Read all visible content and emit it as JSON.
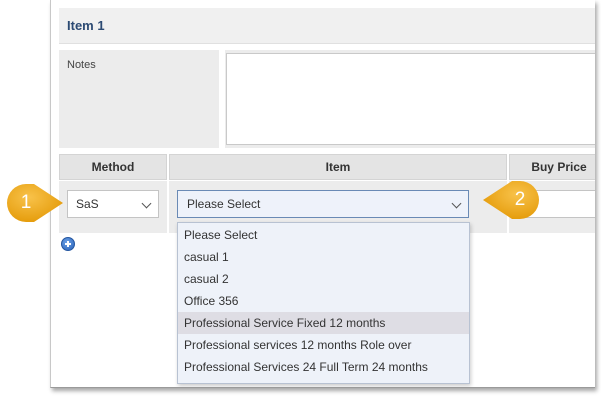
{
  "item": {
    "title": "Item 1",
    "notes_label": "Notes",
    "notes_value": ""
  },
  "table": {
    "headers": {
      "method": "Method",
      "item": "Item",
      "price": "Buy Price"
    },
    "row": {
      "method_value": "SaS",
      "item_value": "Please Select",
      "price_value": ""
    }
  },
  "dropdown": {
    "options": [
      "Please Select",
      "casual 1",
      "casual 2",
      "Office 356",
      "Professional Service Fixed 12 months",
      "Professional services 12 months Role over",
      "Professional Services 24 Full Term 24 months"
    ],
    "highlighted_index": 4
  },
  "callouts": {
    "first": "1",
    "second": "2",
    "color": "#f2a916"
  },
  "icons": {
    "add": "plus-circle-icon",
    "chevron": "chevron-down-icon"
  }
}
